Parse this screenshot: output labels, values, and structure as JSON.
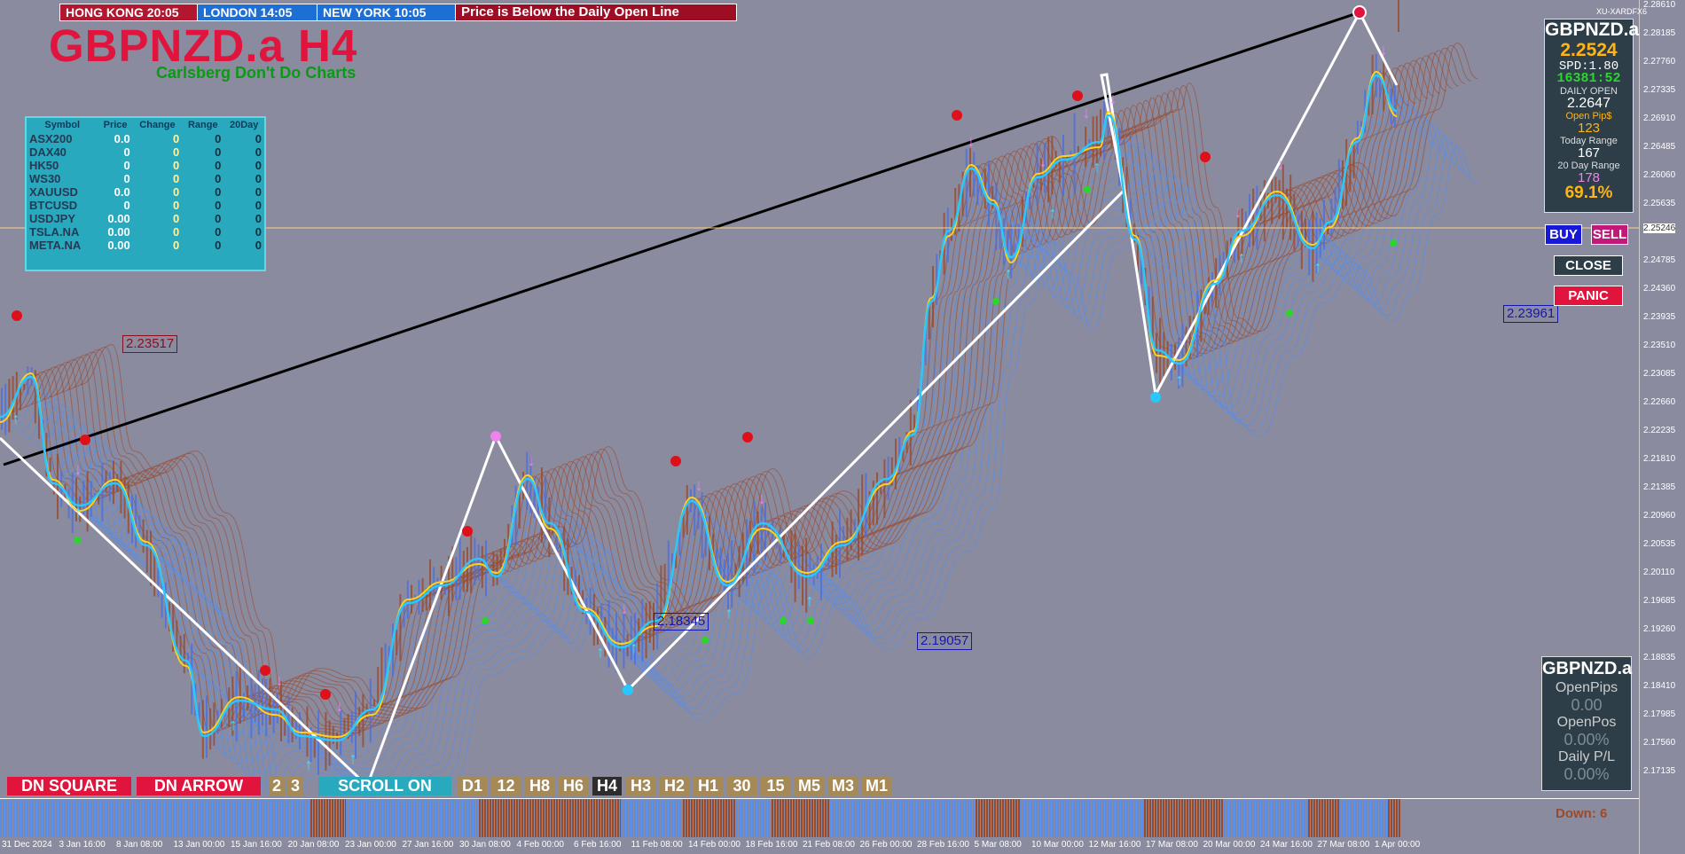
{
  "clocks": {
    "hong_kong": "HONG KONG 20:05",
    "london": "LONDON  14:05",
    "new_york": "NEW YORK  10:05",
    "message": "Price is Below the Daily Open Line"
  },
  "title": "GBPNZD.a H4",
  "subtitle": "Carlsberg Don't Do Charts",
  "market_table": {
    "headers": [
      "Symbol",
      "Price",
      "Change",
      "Range",
      "20Day"
    ],
    "rows": [
      [
        "ASX200",
        "0.0",
        "0",
        "0",
        "0"
      ],
      [
        "DAX40",
        "0",
        "0",
        "0",
        "0"
      ],
      [
        "HK50",
        "0",
        "0",
        "0",
        "0"
      ],
      [
        "WS30",
        "0",
        "0",
        "0",
        "0"
      ],
      [
        "XAUUSD",
        "0.0",
        "0",
        "0",
        "0"
      ],
      [
        "BTCUSD",
        "0",
        "0",
        "0",
        "0"
      ],
      [
        "USDJPY",
        "0.00",
        "0",
        "0",
        "0"
      ],
      [
        "TSLA.NA",
        "0.00",
        "0",
        "0",
        "0"
      ],
      [
        "META.NA",
        "0.00",
        "0",
        "0",
        "0"
      ]
    ]
  },
  "price_labels": {
    "left_resistance": "2.23517",
    "mid_support": "2.19057",
    "low_box": "2.18345",
    "right_target": "2.23961",
    "current": "2.25246"
  },
  "broker": "XU-XARDFX6",
  "info_panel": {
    "symbol": "GBPNZD.a",
    "price": "2.2524",
    "spread": "SPD:1.80",
    "timer": "16381:52",
    "daily_open_label": "DAILY OPEN",
    "daily_open": "2.2647",
    "open_pips_label": "Open Pip$",
    "open_pips": "123",
    "today_range_label": "Today Range",
    "today_range": "167",
    "twenty_day_label": "20 Day Range",
    "twenty_day": "178",
    "ratio": "69.1%"
  },
  "buttons": {
    "buy": "BUY",
    "sell": "SELL",
    "close": "CLOSE",
    "panic": "PANIC"
  },
  "pnl_panel": {
    "symbol": "GBPNZD.a",
    "open_pips_label": "OpenPips",
    "open_pips": "0.00",
    "open_pos_label": "OpenPos",
    "open_pos": "0.00%",
    "daily_pl_label": "Daily P/L",
    "daily_pl": "0.00%"
  },
  "toolbar": {
    "dn_square": "DN SQUARE",
    "dn_arrow": "DN ARROW",
    "n2": "2",
    "n3": "3",
    "scroll": "SCROLL ON",
    "timeframes": [
      "D1",
      "12",
      "H8",
      "H6",
      "H4",
      "H3",
      "H2",
      "H1",
      "30",
      "15",
      "M5",
      "M3",
      "M1"
    ],
    "active_timeframe": "H4"
  },
  "histogram_label": "Down: 6",
  "y_axis_ticks": [
    "2.28610",
    "2.28185",
    "2.27760",
    "2.27335",
    "2.26910",
    "2.26485",
    "2.26060",
    "2.25635",
    "2.25246",
    "2.24785",
    "2.24360",
    "2.23935",
    "2.23510",
    "2.23085",
    "2.22660",
    "2.22235",
    "2.21810",
    "2.21385",
    "2.20960",
    "2.20535",
    "2.20110",
    "2.19685",
    "2.19260",
    "2.18835",
    "2.18410",
    "2.17985",
    "2.17560",
    "2.17135"
  ],
  "x_axis_ticks": [
    "31 Dec 2024",
    "3 Jan 16:00",
    "8 Jan 08:00",
    "13 Jan 00:00",
    "15 Jan 16:00",
    "20 Jan 08:00",
    "23 Jan 00:00",
    "27 Jan 16:00",
    "30 Jan 08:00",
    "4 Feb 00:00",
    "6 Feb 16:00",
    "11 Feb 08:00",
    "14 Feb 00:00",
    "18 Feb 16:00",
    "21 Feb 08:00",
    "26 Feb 00:00",
    "28 Feb 16:00",
    "5 Mar 08:00",
    "10 Mar 00:00",
    "12 Mar 16:00",
    "17 Mar 08:00",
    "20 Mar 00:00",
    "24 Mar 16:00",
    "27 Mar 08:00",
    "1 Apr 00:00"
  ],
  "colors": {
    "background": "#8b8ba0",
    "fast_ma": "#28c8ff",
    "slow_ma": "#ffd21a",
    "ribbon_up": "#5a8ee6",
    "ribbon_down": "#9a4a2a",
    "zigzag": "#ffffff",
    "trendline": "#000000"
  }
}
